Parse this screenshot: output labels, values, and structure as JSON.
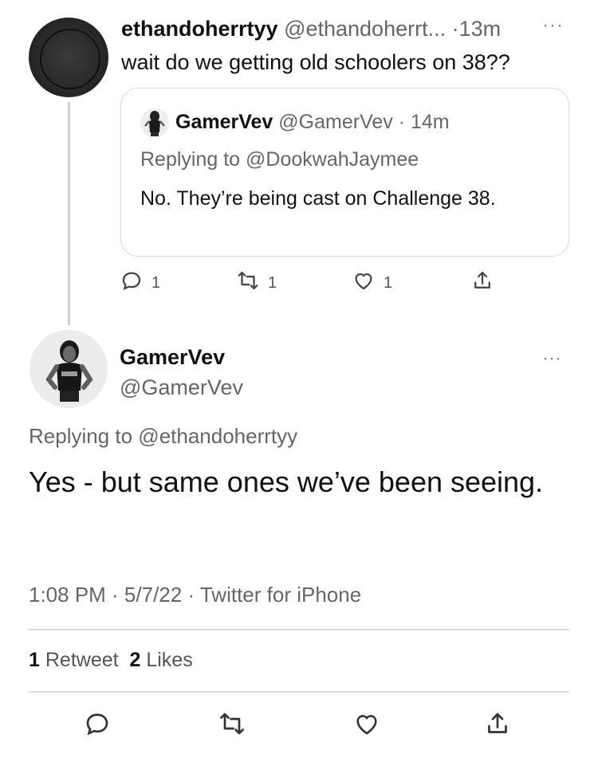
{
  "first_tweet": {
    "display_name": "ethandoherrtyy",
    "handle": "@ethandoherrt...",
    "separator": "·",
    "time": "13m",
    "more_label": "···",
    "text": "wait do we getting old schoolers on 38??",
    "quoted": {
      "display_name": "GamerVev",
      "handle": "@GamerVev",
      "separator": "·",
      "time": "14m",
      "replying_to": "Replying to @DookwahJaymee",
      "text": "No. They’re being cast on Challenge 38."
    },
    "actions": {
      "reply_count": "1",
      "retweet_count": "1",
      "like_count": "1"
    }
  },
  "main_tweet": {
    "display_name": "GamerVev",
    "handle": "@GamerVev",
    "more_label": "···",
    "replying_to": "Replying to @ethandoherrtyy",
    "text": "Yes - but same ones we’ve been seeing.",
    "meta": "1:08 PM · 5/7/22 · Twitter for iPhone",
    "retweets_count": "1",
    "retweets_label": "Retweet",
    "likes_count": "2",
    "likes_label": "Likes"
  },
  "icons": {
    "reply": "reply-icon",
    "retweet": "retweet-icon",
    "like": "heart-icon",
    "share": "share-icon"
  },
  "colors": {
    "text": "#111111",
    "muted": "#666666",
    "divider": "#dcdcdc"
  }
}
